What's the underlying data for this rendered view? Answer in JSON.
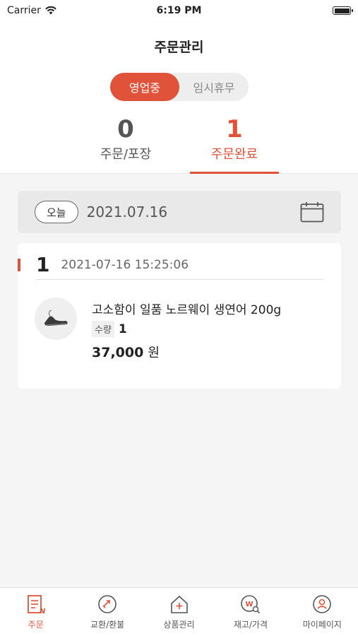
{
  "status_bar": {
    "carrier": "Carrier",
    "time": "6:19 PM"
  },
  "header": {
    "title": "주문관리"
  },
  "toggle": {
    "active": "영업중",
    "inactive": "임시휴무"
  },
  "tabs": [
    {
      "count": "0",
      "label": "주문/포장"
    },
    {
      "count": "1",
      "label": "주문완료"
    }
  ],
  "date_bar": {
    "today_label": "오늘",
    "date": "2021.07.16"
  },
  "order": {
    "number": "1",
    "time": "2021-07-16 15:25:06",
    "product_name": "고소함이 일품 노르웨이 생연어 200g",
    "qty_label": "수량",
    "qty_value": "1",
    "price": "37,000",
    "currency": "원"
  },
  "tabbar": [
    {
      "label": "주문",
      "icon": "order-list-icon"
    },
    {
      "label": "교환/환불",
      "icon": "exchange-refund-icon"
    },
    {
      "label": "상품관리",
      "icon": "product-management-icon"
    },
    {
      "label": "재고/가격",
      "icon": "inventory-price-icon"
    },
    {
      "label": "마이페이지",
      "icon": "mypage-icon"
    }
  ],
  "colors": {
    "accent": "#e0533a",
    "background": "#f5f5f5"
  }
}
